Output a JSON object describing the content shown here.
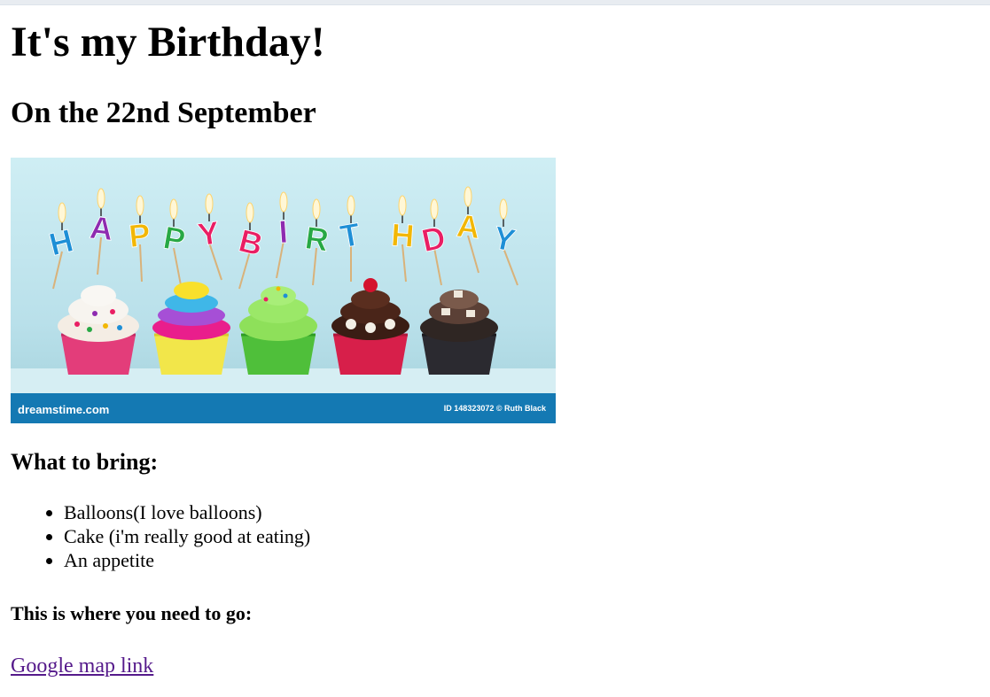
{
  "page": {
    "title": "It's my Birthday!",
    "subtitle": "On the 22nd September"
  },
  "banner": {
    "letters": [
      "H",
      "A",
      "P",
      "P",
      "Y",
      "B",
      "I",
      "R",
      "T",
      "H",
      "D",
      "A",
      "Y"
    ],
    "letter_colors": [
      "#1e8fd6",
      "#8e2bb0",
      "#f2b705",
      "#27a844",
      "#e91e63",
      "#e91e63",
      "#8e2bb0",
      "#27a844",
      "#1e8fd6",
      "#f2b705",
      "#e91e63",
      "#f2b705",
      "#1e8fd6"
    ],
    "watermark_left": "dreamstime.com",
    "watermark_right": "ID 148323072 © Ruth Black",
    "background_color": "#c4e6ee",
    "strip_color": "#1479b3"
  },
  "bring": {
    "heading": "What to bring:",
    "items": [
      "Balloons(I love balloons)",
      "Cake (i'm really good at eating)",
      "An appetite"
    ]
  },
  "directions": {
    "heading": "This is where you need to go:",
    "link_label": "Google map link"
  }
}
